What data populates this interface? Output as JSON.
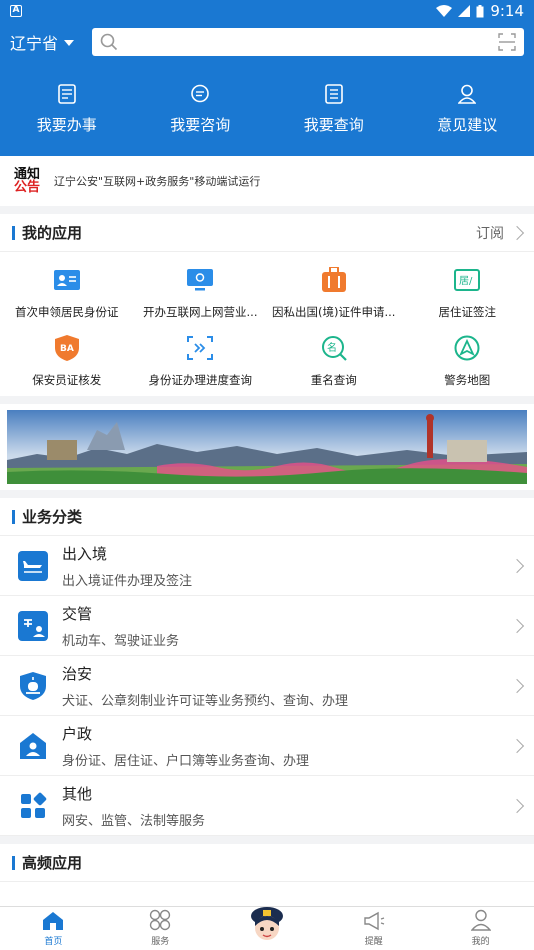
{
  "status": {
    "time": "9:14"
  },
  "header": {
    "province": "辽宁省",
    "search_placeholder": ""
  },
  "quick": [
    {
      "label": "我要办事",
      "icon": "document-icon"
    },
    {
      "label": "我要咨询",
      "icon": "chat-icon"
    },
    {
      "label": "我要查询",
      "icon": "list-icon"
    },
    {
      "label": "意见建议",
      "icon": "person-icon"
    }
  ],
  "notice": {
    "logo_top": "通知",
    "logo_bottom": "公告",
    "text": "辽宁公安\"互联网+政务服务\"移动端试运行"
  },
  "my_apps": {
    "title": "我的应用",
    "subscribe": "订阅",
    "items": [
      {
        "label": "首次申领居民身份证",
        "icon": "id-card-icon",
        "color": "#2b8de8"
      },
      {
        "label": "开办互联网上网营业...",
        "icon": "monitor-icon",
        "color": "#2b8de8"
      },
      {
        "label": "因私出国(境)证件申请...",
        "icon": "luggage-icon",
        "color": "#f07a2e"
      },
      {
        "label": "居住证签注",
        "icon": "residence-icon",
        "color": "#1cb58c"
      },
      {
        "label": "保安员证核发",
        "icon": "shield-ba-icon",
        "color": "#f07a2e"
      },
      {
        "label": "身份证办理进度查询",
        "icon": "progress-scan-icon",
        "color": "#2b8de8"
      },
      {
        "label": "重名查询",
        "icon": "name-search-icon",
        "color": "#1cb58c"
      },
      {
        "label": "警务地图",
        "icon": "map-nav-icon",
        "color": "#1cb58c"
      }
    ]
  },
  "categories": {
    "title": "业务分类",
    "items": [
      {
        "title": "出入境",
        "sub": "出入境证件办理及签注",
        "icon": "plane-icon"
      },
      {
        "title": "交管",
        "sub": "机动车、驾驶证业务",
        "icon": "traffic-icon"
      },
      {
        "title": "治安",
        "sub": "犬证、公章刻制业许可证等业务预约、查询、办理",
        "icon": "police-light-icon"
      },
      {
        "title": "户政",
        "sub": "身份证、居住证、户口簿等业务查询、办理",
        "icon": "household-icon"
      },
      {
        "title": "其他",
        "sub": "网安、监管、法制等服务",
        "icon": "grid-icon"
      }
    ]
  },
  "frequent": {
    "title": "高频应用"
  },
  "tabs": [
    {
      "label": "首页",
      "icon": "home-icon",
      "active": true
    },
    {
      "label": "服务",
      "icon": "services-icon",
      "active": false
    },
    {
      "label": "",
      "icon": "police-mascot-icon",
      "active": false
    },
    {
      "label": "提醒",
      "icon": "megaphone-icon",
      "active": false
    },
    {
      "label": "我的",
      "icon": "profile-icon",
      "active": false
    }
  ],
  "colors": {
    "primary": "#1a78d2"
  }
}
